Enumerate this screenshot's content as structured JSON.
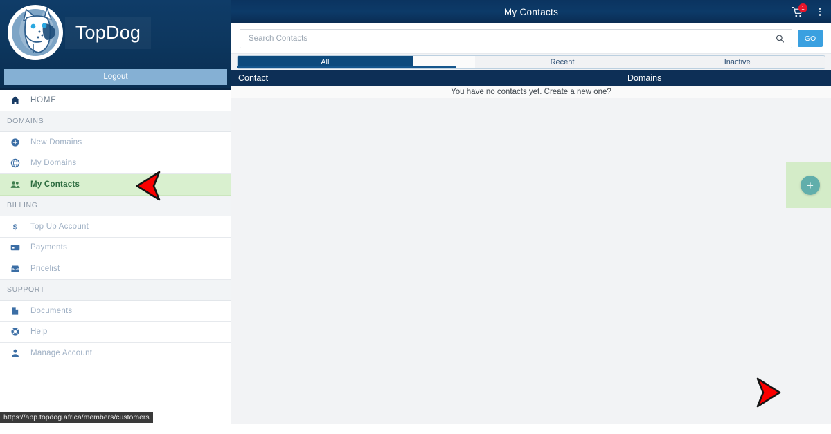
{
  "brand": {
    "name": "TopDog",
    "logo_icon": "dog-head-logo",
    "logout_label": "Logout"
  },
  "sidebar": {
    "items": [
      {
        "label": "HOME",
        "icon": "home-icon",
        "type": "item",
        "name": "home",
        "active": false
      },
      {
        "label": "DOMAINS",
        "type": "section",
        "name": "domains"
      },
      {
        "label": "New Domains",
        "icon": "plus-circle-icon",
        "type": "item",
        "name": "new-domains",
        "active": false
      },
      {
        "label": "My Domains",
        "icon": "globe-icon",
        "type": "item",
        "name": "my-domains",
        "active": false
      },
      {
        "label": "My Contacts",
        "icon": "people-icon",
        "type": "item",
        "name": "my-contacts",
        "active": true
      },
      {
        "label": "BILLING",
        "type": "section",
        "name": "billing"
      },
      {
        "label": "Top Up Account",
        "icon": "dollar-icon",
        "type": "item",
        "name": "top-up-account",
        "active": false
      },
      {
        "label": "Payments",
        "icon": "credit-card-icon",
        "type": "item",
        "name": "payments",
        "active": false
      },
      {
        "label": "Pricelist",
        "icon": "inbox-icon",
        "type": "item",
        "name": "pricelist",
        "active": false
      },
      {
        "label": "SUPPORT",
        "type": "section",
        "name": "support"
      },
      {
        "label": "Documents",
        "icon": "document-icon",
        "type": "item",
        "name": "documents",
        "active": false
      },
      {
        "label": "Help",
        "icon": "lifebuoy-icon",
        "type": "item",
        "name": "help",
        "active": false
      },
      {
        "label": "Manage Account",
        "icon": "user-icon",
        "type": "item",
        "name": "manage-account",
        "active": false
      }
    ]
  },
  "header": {
    "title": "My Contacts",
    "cart_icon": "shopping-cart-icon",
    "cart_badge_count": "1",
    "menu_icon": "kebab-menu-icon"
  },
  "search": {
    "placeholder": "Search Contacts",
    "value": "",
    "icon": "search-icon",
    "go_label": "GO"
  },
  "tabs": [
    {
      "label": "All",
      "name": "all",
      "active": true
    },
    {
      "label": "Recent",
      "name": "recent",
      "active": false
    },
    {
      "label": "Inactive",
      "name": "inactive",
      "active": false
    }
  ],
  "table": {
    "columns": [
      "Contact",
      "Domains"
    ],
    "empty_message": "You have no contacts yet. Create a new one?",
    "rows": []
  },
  "fab": {
    "label": "+",
    "icon": "plus-icon"
  },
  "status_bar": {
    "url": "https://app.topdog.africa/members/customers"
  },
  "colors": {
    "brand_navy": "#0c3a68",
    "header_navy": "#0d2f56",
    "accent_blue": "#3aa0e0",
    "active_tab": "#0d4a7d",
    "highlight_green": "#d9f0cf",
    "active_text_green": "#2c6b3f",
    "badge_red": "#e8162c",
    "fab_teal": "#61aeab",
    "annotation_red": "#fb0000"
  }
}
